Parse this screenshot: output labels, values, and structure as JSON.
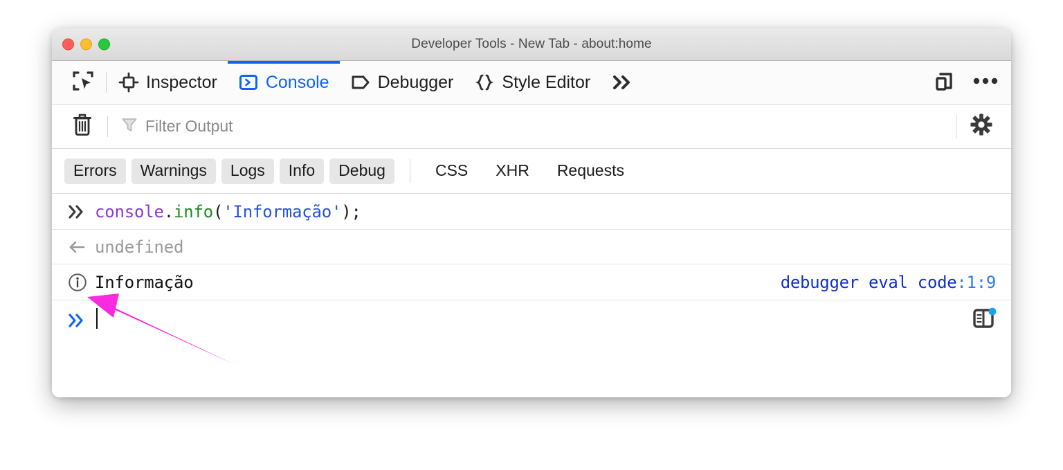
{
  "window": {
    "title": "Developer Tools - New Tab - about:home",
    "traffic_lights": [
      {
        "name": "close",
        "color": "#ff5f57"
      },
      {
        "name": "minimize",
        "color": "#febc2e"
      },
      {
        "name": "zoom",
        "color": "#28c840"
      }
    ]
  },
  "toolbar": {
    "picker_icon": "element-picker-icon",
    "tabs": [
      {
        "label": "Inspector",
        "icon": "inspector-icon",
        "active": false
      },
      {
        "label": "Console",
        "icon": "console-icon",
        "active": true
      },
      {
        "label": "Debugger",
        "icon": "debugger-icon",
        "active": false
      },
      {
        "label": "Style Editor",
        "icon": "style-editor-icon",
        "active": false
      }
    ],
    "overflow_icon": "chevron-double-right-icon",
    "responsive_icon": "responsive-design-mode-icon",
    "meatball_icon": "more-options-icon",
    "active_accent": "#0a65f6"
  },
  "filterbar": {
    "clear_icon": "trash-icon",
    "filter_icon": "funnel-icon",
    "filter_placeholder": "Filter Output",
    "filter_value": "",
    "settings_icon": "gear-icon"
  },
  "filters": {
    "pills": [
      {
        "label": "Errors",
        "selected": true
      },
      {
        "label": "Warnings",
        "selected": true
      },
      {
        "label": "Logs",
        "selected": true
      },
      {
        "label": "Info",
        "selected": true
      },
      {
        "label": "Debug",
        "selected": true
      }
    ],
    "plain": [
      {
        "label": "CSS",
        "selected": false
      },
      {
        "label": "XHR",
        "selected": false
      },
      {
        "label": "Requests",
        "selected": false
      }
    ]
  },
  "console": {
    "input_row": {
      "gutter_icon": "chevron-double-right-icon",
      "tokens": [
        {
          "text": "console",
          "type": "object"
        },
        {
          "text": ".",
          "type": "punct"
        },
        {
          "text": "info",
          "type": "function"
        },
        {
          "text": "(",
          "type": "punct"
        },
        {
          "text": "'Informação'",
          "type": "string"
        },
        {
          "text": ")",
          "type": "punct"
        },
        {
          "text": ";",
          "type": "punct"
        }
      ],
      "full_text": "console.info('Informação');"
    },
    "return_row": {
      "gutter_icon": "arrow-left-icon",
      "text": "undefined"
    },
    "info_row": {
      "gutter_icon": "info-circle-icon",
      "text": "Informação",
      "source_file": "debugger eval code",
      "source_position": ":1:9"
    },
    "prompt_row": {
      "gutter_icon": "chevron-double-right-icon",
      "value": "",
      "split_icon": "split-console-icon",
      "split_badge": true
    }
  },
  "annotation": {
    "arrow_color": "#f92ae0",
    "points_at": "info-circle-icon"
  }
}
